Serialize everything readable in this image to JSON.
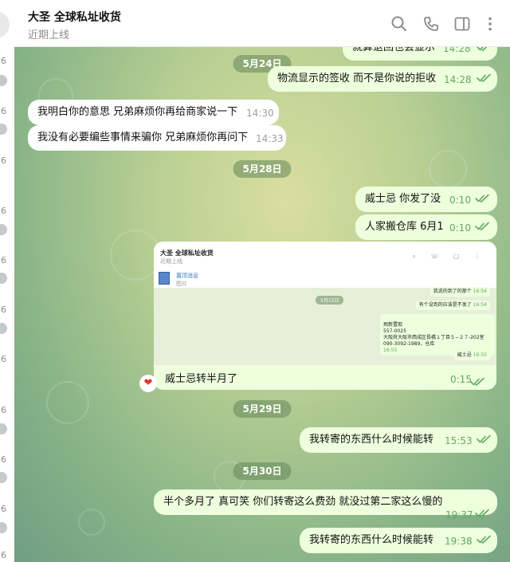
{
  "sidebar": {
    "numbers": [
      "6",
      "6",
      "6",
      "6",
      "6",
      "6",
      "6",
      "6",
      "6",
      "6",
      "6",
      "6"
    ]
  },
  "header": {
    "title": "大圣 全球私址收货",
    "status": "近期上线",
    "icons": [
      "search-icon",
      "phone-icon",
      "sidebar-toggle-icon",
      "more-vertical-icon"
    ]
  },
  "chat": {
    "dates": [
      "5月24日",
      "5月28日",
      "5月29日",
      "5月30日"
    ],
    "messages": [
      {
        "text": "就算退回也会显示",
        "time": "14:28"
      },
      {
        "text": "物流显示的签收 而不是你说的拒收",
        "time": "14:28"
      },
      {
        "text": "我明白你的意思 兄弟麻烦你再给商家说一下",
        "time": "14:30"
      },
      {
        "text": "我没有必要编些事情来骗你 兄弟麻烦你再问下",
        "time": "14:33"
      },
      {
        "text": "威士忌 你发了没",
        "time": "0:10"
      },
      {
        "text": "人家搬仓库 6月1",
        "time": "0:10"
      },
      {
        "text": "我转寄的东西什么时候能转",
        "time": "15:53"
      },
      {
        "text": "半个多月了 真可笑 你们转寄这么费劲 就没过第二家这么慢的",
        "time": "19:37"
      },
      {
        "text": "我转寄的东西什么时候能转",
        "time": "19:38"
      }
    ],
    "image_message": {
      "caption": "威士忌转半月了",
      "time": "0:15",
      "reaction": "❤",
      "screenshot": {
        "title": "大圣 全球私址收货",
        "status": "近期上线",
        "pinned_title": "置顶消息",
        "pinned_sub": "图片",
        "date": "5月15日",
        "bubbles": [
          {
            "text": "我说的到了的那个",
            "time": "16:54"
          },
          {
            "text": "有个没到的应该是不发了",
            "time": "16:54"
          },
          {
            "text": "飛新置取\n557-0025\n大阪府大阪市西成区長橋１丁目５−２７-202室\n090-3092-1989，仓库",
            "time": "16:55"
          },
          {
            "text": "威士忌",
            "time": "16:55"
          }
        ]
      }
    }
  },
  "colors": {
    "outgoing_bubble": "#eeffde",
    "incoming_bubble": "#ffffff",
    "check_green": "#5fa960",
    "date_pill": "#6a8a5e"
  }
}
